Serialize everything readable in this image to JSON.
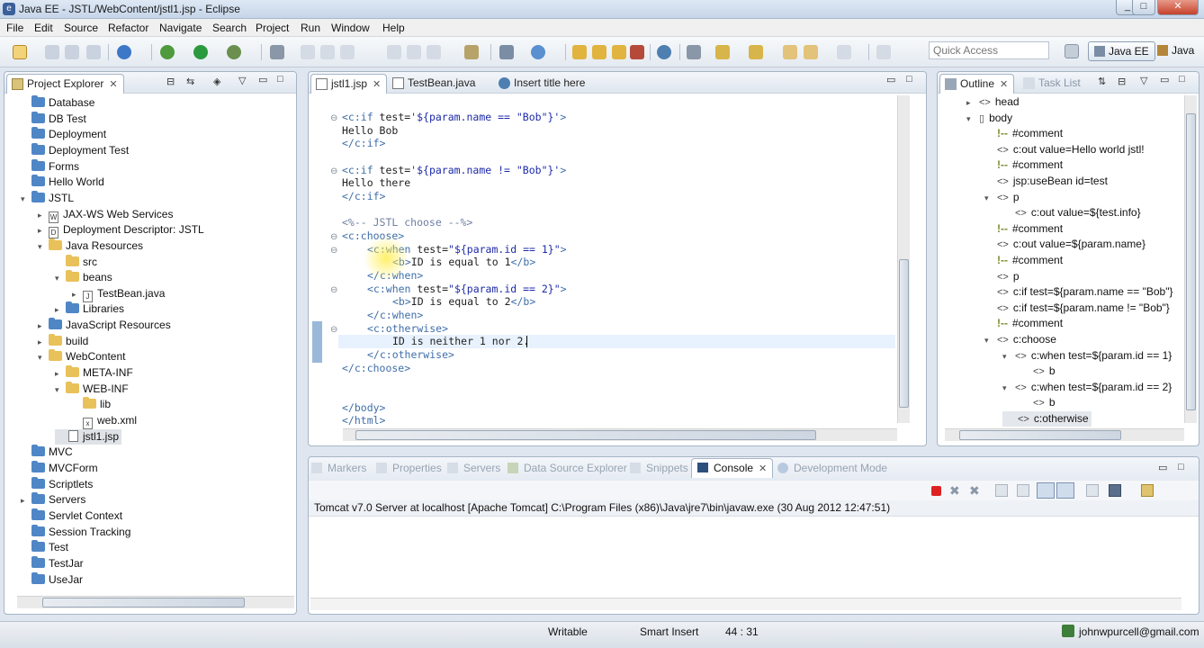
{
  "window": {
    "title": "Java EE - JSTL/WebContent/jstl1.jsp - Eclipse"
  },
  "menu": [
    "File",
    "Edit",
    "Source",
    "Refactor",
    "Navigate",
    "Search",
    "Project",
    "Run",
    "Window",
    "Help"
  ],
  "toolbar": {
    "quick_access_placeholder": "Quick Access",
    "perspectives": [
      "Java EE",
      "Java"
    ]
  },
  "project_explorer": {
    "tab_label": "Project Explorer",
    "items": [
      {
        "label": "Database",
        "level": 0,
        "icon": "folder"
      },
      {
        "label": "DB Test",
        "level": 0,
        "icon": "folder"
      },
      {
        "label": "Deployment",
        "level": 0,
        "icon": "folder"
      },
      {
        "label": "Deployment Test",
        "level": 0,
        "icon": "folder"
      },
      {
        "label": "Forms",
        "level": 0,
        "icon": "folder"
      },
      {
        "label": "Hello World",
        "level": 0,
        "icon": "folder"
      },
      {
        "label": "JSTL",
        "level": 0,
        "icon": "project",
        "arrow": "▾"
      },
      {
        "label": "JAX-WS Web Services",
        "level": 1,
        "icon": "service",
        "arrow": "▸"
      },
      {
        "label": "Deployment Descriptor: JSTL",
        "level": 1,
        "icon": "descriptor",
        "arrow": "▸"
      },
      {
        "label": "Java Resources",
        "level": 1,
        "icon": "jres",
        "arrow": "▾"
      },
      {
        "label": "src",
        "level": 2,
        "icon": "package"
      },
      {
        "label": "beans",
        "level": 2,
        "icon": "package",
        "arrow": "▾"
      },
      {
        "label": "TestBean.java",
        "level": 3,
        "icon": "java",
        "arrow": "▸"
      },
      {
        "label": "Libraries",
        "level": 2,
        "icon": "library",
        "arrow": "▸"
      },
      {
        "label": "JavaScript Resources",
        "level": 1,
        "icon": "jsres",
        "arrow": "▸"
      },
      {
        "label": "build",
        "level": 1,
        "icon": "folder-yellow",
        "arrow": "▸"
      },
      {
        "label": "WebContent",
        "level": 1,
        "icon": "folder-yellow",
        "arrow": "▾"
      },
      {
        "label": "META-INF",
        "level": 2,
        "icon": "folder-yellow",
        "arrow": "▸"
      },
      {
        "label": "WEB-INF",
        "level": 2,
        "icon": "folder-yellow",
        "arrow": "▾"
      },
      {
        "label": "lib",
        "level": 3,
        "icon": "folder-yellow"
      },
      {
        "label": "web.xml",
        "level": 3,
        "icon": "xml"
      },
      {
        "label": "jstl1.jsp",
        "level": 2,
        "icon": "jsp",
        "selected": true
      },
      {
        "label": "MVC",
        "level": 0,
        "icon": "folder"
      },
      {
        "label": "MVCForm",
        "level": 0,
        "icon": "folder"
      },
      {
        "label": "Scriptlets",
        "level": 0,
        "icon": "folder"
      },
      {
        "label": "Servers",
        "level": 0,
        "icon": "folder",
        "arrow": "▸"
      },
      {
        "label": "Servlet Context",
        "level": 0,
        "icon": "folder"
      },
      {
        "label": "Session Tracking",
        "level": 0,
        "icon": "folder"
      },
      {
        "label": "Test",
        "level": 0,
        "icon": "folder"
      },
      {
        "label": "TestJar",
        "level": 0,
        "icon": "folder"
      },
      {
        "label": "UseJar",
        "level": 0,
        "icon": "folder"
      }
    ]
  },
  "editor": {
    "tabs": [
      {
        "label": "jstl1.jsp",
        "active": true
      },
      {
        "label": "TestBean.java",
        "active": false
      },
      {
        "label": "Insert title here",
        "active": false
      }
    ],
    "lines": [
      {
        "indent": 0,
        "parts": [
          {
            "c": "k",
            "t": "<c:if "
          },
          {
            "c": "t",
            "t": "test="
          },
          {
            "c": "s",
            "t": "'${param.name == \"Bob\"}'"
          },
          {
            "c": "k",
            "t": ">"
          }
        ]
      },
      {
        "indent": 0,
        "parts": [
          {
            "c": "t",
            "t": "Hello Bob"
          }
        ]
      },
      {
        "indent": 0,
        "parts": [
          {
            "c": "k",
            "t": "</c:if>"
          }
        ]
      },
      {
        "indent": 0,
        "parts": []
      },
      {
        "indent": 0,
        "parts": [
          {
            "c": "k",
            "t": "<c:if "
          },
          {
            "c": "t",
            "t": "test="
          },
          {
            "c": "s",
            "t": "'${param.name != \"Bob\"}'"
          },
          {
            "c": "k",
            "t": ">"
          }
        ]
      },
      {
        "indent": 0,
        "parts": [
          {
            "c": "t",
            "t": "Hello there"
          }
        ]
      },
      {
        "indent": 0,
        "parts": [
          {
            "c": "k",
            "t": "</c:if>"
          }
        ]
      },
      {
        "indent": 0,
        "parts": []
      },
      {
        "indent": 0,
        "parts": [
          {
            "c": "cm",
            "t": "<%-- JSTL choose --%>"
          }
        ]
      },
      {
        "indent": 0,
        "parts": [
          {
            "c": "k",
            "t": "<c:choose>"
          }
        ]
      },
      {
        "indent": 1,
        "parts": [
          {
            "c": "k",
            "t": "<c:when "
          },
          {
            "c": "t",
            "t": "test="
          },
          {
            "c": "s",
            "t": "\"${param.id == 1}\""
          },
          {
            "c": "k",
            "t": ">"
          }
        ]
      },
      {
        "indent": 2,
        "parts": [
          {
            "c": "k",
            "t": "<b>"
          },
          {
            "c": "t",
            "t": "ID is equal to 1"
          },
          {
            "c": "k",
            "t": "</b>"
          }
        ]
      },
      {
        "indent": 1,
        "parts": [
          {
            "c": "k",
            "t": "</c:when>"
          }
        ]
      },
      {
        "indent": 1,
        "parts": [
          {
            "c": "k",
            "t": "<c:when "
          },
          {
            "c": "t",
            "t": "test="
          },
          {
            "c": "s",
            "t": "\"${param.id == 2}\""
          },
          {
            "c": "k",
            "t": ">"
          }
        ]
      },
      {
        "indent": 2,
        "parts": [
          {
            "c": "k",
            "t": "<b>"
          },
          {
            "c": "t",
            "t": "ID is equal to 2"
          },
          {
            "c": "k",
            "t": "</b>"
          }
        ]
      },
      {
        "indent": 1,
        "parts": [
          {
            "c": "k",
            "t": "</c:when>"
          }
        ]
      },
      {
        "indent": 1,
        "parts": [
          {
            "c": "k",
            "t": "<c:otherwise>"
          }
        ]
      },
      {
        "indent": 2,
        "parts": [
          {
            "c": "t",
            "t": "ID is neither 1 nor 2."
          }
        ]
      },
      {
        "indent": 1,
        "parts": [
          {
            "c": "k",
            "t": "</c:otherwise>"
          }
        ]
      },
      {
        "indent": 0,
        "parts": [
          {
            "c": "k",
            "t": "</c:choose>"
          }
        ]
      },
      {
        "indent": 0,
        "parts": []
      },
      {
        "indent": 0,
        "parts": []
      },
      {
        "indent": 0,
        "parts": [
          {
            "c": "k",
            "t": "</body>"
          }
        ]
      },
      {
        "indent": 0,
        "parts": [
          {
            "c": "k",
            "t": "</html>"
          }
        ]
      }
    ]
  },
  "outline": {
    "tabs": [
      "Outline",
      "Task List"
    ],
    "items": [
      {
        "label": "head",
        "level": 0,
        "kind": "tag",
        "arrow": "▸"
      },
      {
        "label": "body",
        "level": 0,
        "kind": "body",
        "arrow": "▾"
      },
      {
        "label": "#comment",
        "level": 1,
        "kind": "comment"
      },
      {
        "label": "c:out value=Hello world jstl!",
        "level": 1,
        "kind": "tag"
      },
      {
        "label": "#comment",
        "level": 1,
        "kind": "comment"
      },
      {
        "label": "jsp:useBean id=test",
        "level": 1,
        "kind": "tag"
      },
      {
        "label": "p",
        "level": 1,
        "kind": "tag",
        "arrow": "▾"
      },
      {
        "label": "c:out value=${test.info}",
        "level": 2,
        "kind": "tag"
      },
      {
        "label": "#comment",
        "level": 1,
        "kind": "comment"
      },
      {
        "label": "c:out value=${param.name}",
        "level": 1,
        "kind": "tag"
      },
      {
        "label": "#comment",
        "level": 1,
        "kind": "comment"
      },
      {
        "label": "p",
        "level": 1,
        "kind": "tag"
      },
      {
        "label": "c:if test=${param.name == \"Bob\"}",
        "level": 1,
        "kind": "tag"
      },
      {
        "label": "c:if test=${param.name != \"Bob\"}",
        "level": 1,
        "kind": "tag"
      },
      {
        "label": "#comment",
        "level": 1,
        "kind": "comment"
      },
      {
        "label": "c:choose",
        "level": 1,
        "kind": "tag",
        "arrow": "▾"
      },
      {
        "label": "c:when test=${param.id == 1}",
        "level": 2,
        "kind": "tag",
        "arrow": "▾"
      },
      {
        "label": "b",
        "level": 3,
        "kind": "tag"
      },
      {
        "label": "c:when test=${param.id == 2}",
        "level": 2,
        "kind": "tag",
        "arrow": "▾"
      },
      {
        "label": "b",
        "level": 3,
        "kind": "tag"
      },
      {
        "label": "c:otherwise",
        "level": 2,
        "kind": "tag",
        "selected": true
      }
    ]
  },
  "bottom": {
    "tabs": [
      {
        "label": "Markers",
        "active": false
      },
      {
        "label": "Properties",
        "active": false
      },
      {
        "label": "Servers",
        "active": false
      },
      {
        "label": "Data Source Explorer",
        "active": false
      },
      {
        "label": "Snippets",
        "active": false
      },
      {
        "label": "Console",
        "active": true
      },
      {
        "label": "Development Mode",
        "active": false
      }
    ],
    "console_text": "Tomcat v7.0 Server at localhost [Apache Tomcat] C:\\Program Files (x86)\\Java\\jre7\\bin\\javaw.exe (30 Aug 2012 12:47:51)"
  },
  "status": {
    "writable": "Writable",
    "insert_mode": "Smart Insert",
    "position": "44 : 31",
    "user": "johnwpurcell@gmail.com"
  },
  "colors": {
    "keyword": "#3f6ea8",
    "string": "#1d2aa8",
    "comment": "#6f7fa3",
    "selection": "#cfe1f7"
  }
}
